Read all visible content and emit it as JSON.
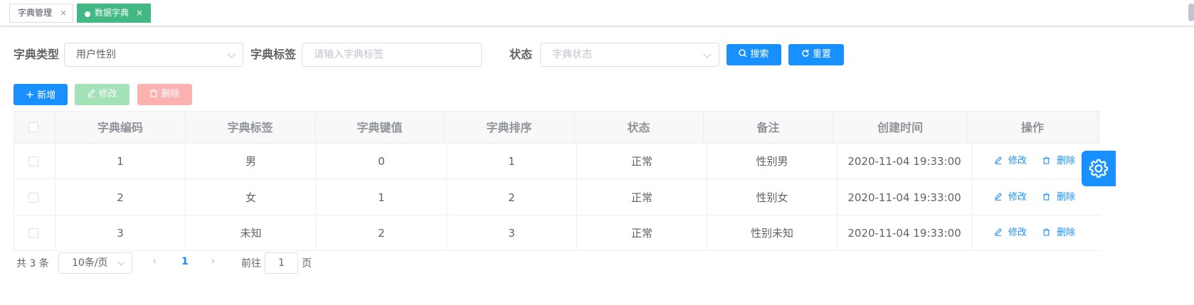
{
  "tabs": [
    {
      "label": "字典管理",
      "close": "×",
      "active": false
    },
    {
      "label": "数据字典",
      "close": "×",
      "active": true
    }
  ],
  "search": {
    "dict_type_label": "字典类型",
    "dict_type_value": "用户性别",
    "dict_label_label": "字典标签",
    "dict_label_placeholder": "请输入字典标签",
    "status_label": "状态",
    "status_placeholder": "字典状态",
    "search_button": "搜索",
    "reset_button": "重置"
  },
  "toolbar": {
    "add_label": "新增",
    "edit_label": "修改",
    "delete_label": "删除"
  },
  "table": {
    "headers": [
      "字典编码",
      "字典标签",
      "字典键值",
      "字典排序",
      "状态",
      "备注",
      "创建时间",
      "操作"
    ],
    "rows": [
      {
        "code": "1",
        "label": "男",
        "value": "0",
        "sort": "1",
        "status": "正常",
        "remark": "性别男",
        "created": "2020-11-04 19:33:00"
      },
      {
        "code": "2",
        "label": "女",
        "value": "1",
        "sort": "2",
        "status": "正常",
        "remark": "性别女",
        "created": "2020-11-04 19:33:00"
      },
      {
        "code": "3",
        "label": "未知",
        "value": "2",
        "sort": "3",
        "status": "正常",
        "remark": "性别未知",
        "created": "2020-11-04 19:33:00"
      }
    ],
    "row_edit": "修改",
    "row_delete": "删除"
  },
  "pagination": {
    "total_text": "共 3 条",
    "page_size": "10条/页",
    "current_page": "1",
    "goto_prefix": "前往",
    "goto_value": "1",
    "goto_suffix": "页"
  },
  "colors": {
    "primary": "#1890ff",
    "success_disabled": "#a3e1b7",
    "danger_disabled": "#fdb2b2",
    "active_tag": "#42b983"
  }
}
